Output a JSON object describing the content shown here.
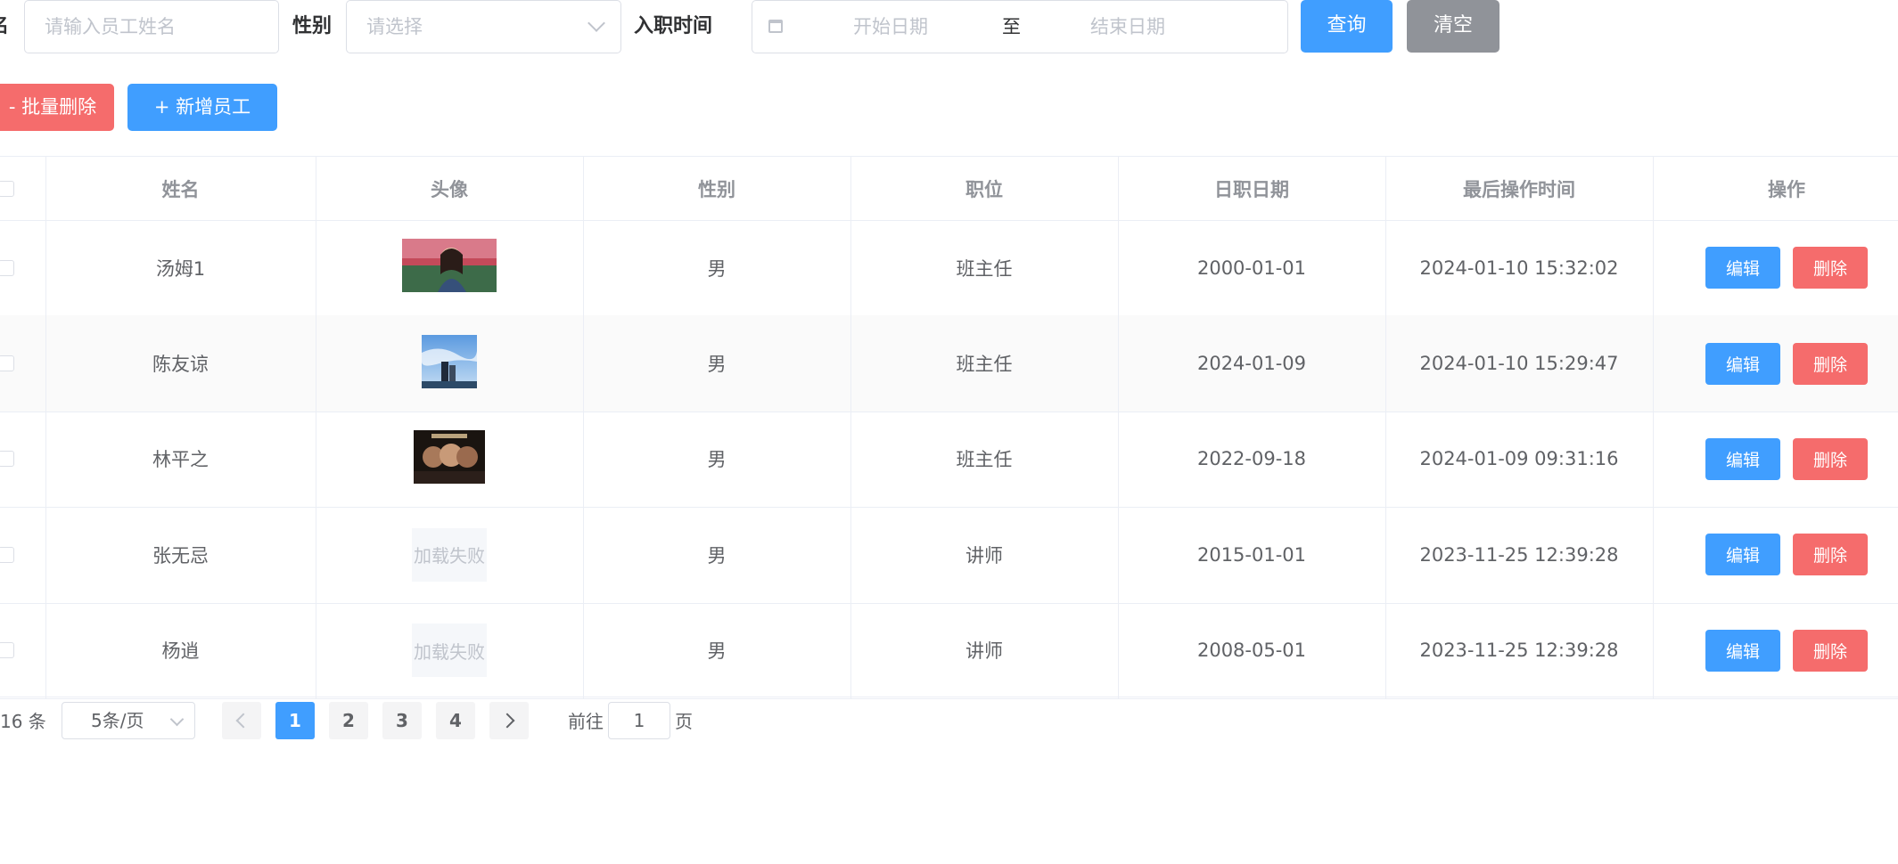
{
  "search": {
    "name_label_fragment": "名",
    "name_placeholder": "请输入员工姓名",
    "gender_label": "性别",
    "gender_placeholder": "请选择",
    "entry_date_label": "入职时间",
    "start_placeholder": "开始日期",
    "range_separator": "至",
    "end_placeholder": "结束日期",
    "query_button": "查询",
    "clear_button": "清空"
  },
  "actions": {
    "batch_delete": "- 批量删除",
    "add_employee": "+ 新增员工"
  },
  "table": {
    "headers": [
      "姓名",
      "头像",
      "性别",
      "职位",
      "日职日期",
      "最后操作时间",
      "操作"
    ],
    "rows": [
      {
        "name": "汤姆1",
        "avatar": "photo-woman",
        "gender": "男",
        "job": "班主任",
        "entry_date": "2000-01-01",
        "update_time": "2024-01-10 15:32:02"
      },
      {
        "name": "陈友谅",
        "avatar": "photo-sky",
        "gender": "男",
        "job": "班主任",
        "entry_date": "2024-01-09",
        "update_time": "2024-01-10 15:29:47"
      },
      {
        "name": "林平之",
        "avatar": "photo-poster",
        "gender": "男",
        "job": "班主任",
        "entry_date": "2022-09-18",
        "update_time": "2024-01-09 09:31:16"
      },
      {
        "name": "张无忌",
        "avatar": "failed",
        "avatar_fail_text": "加载失败",
        "gender": "男",
        "job": "讲师",
        "entry_date": "2015-01-01",
        "update_time": "2023-11-25 12:39:28"
      },
      {
        "name": "杨逍",
        "avatar": "failed",
        "avatar_fail_text": "加载失败",
        "gender": "男",
        "job": "讲师",
        "entry_date": "2008-05-01",
        "update_time": "2023-11-25 12:39:28"
      }
    ],
    "edit_label": "编辑",
    "delete_label": "删除"
  },
  "pagination": {
    "total_text": "16 条",
    "page_size": "5条/页",
    "pages": [
      "1",
      "2",
      "3",
      "4"
    ],
    "current_page": "1",
    "goto_prefix": "前往",
    "goto_value": "1",
    "goto_suffix": "页"
  },
  "colors": {
    "primary": "#409eff",
    "danger": "#f56c6c",
    "info": "#909399"
  }
}
